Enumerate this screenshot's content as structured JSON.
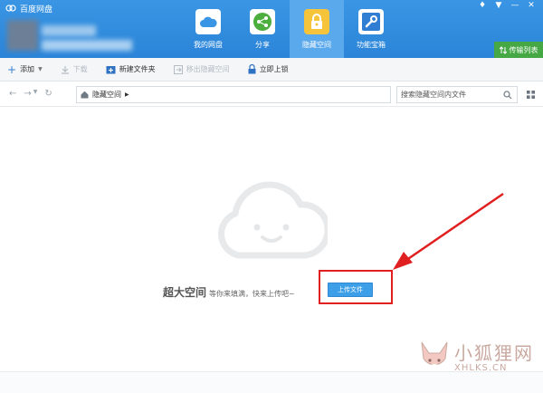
{
  "app": {
    "title": "百度网盘"
  },
  "nav": {
    "tabs": [
      {
        "label": "我的网盘",
        "icon": "cloud-icon",
        "active": false
      },
      {
        "label": "分享",
        "icon": "share-icon",
        "active": false
      },
      {
        "label": "隐藏空间",
        "icon": "lock-icon",
        "active": true
      },
      {
        "label": "功能宝箱",
        "icon": "tools-icon",
        "active": false
      }
    ]
  },
  "window_controls": [
    "bell-icon",
    "menu-icon",
    "minimize-icon",
    "close-icon"
  ],
  "transfer": {
    "label": "传输列表"
  },
  "toolbar": {
    "add": "添加",
    "download": "下载",
    "new_folder": "新建文件夹",
    "move_out": "移出隐藏空间",
    "lock_now": "立即上锁"
  },
  "address": {
    "path": "隐藏空间",
    "search_placeholder": "搜索隐藏空间内文件"
  },
  "empty": {
    "title": "超大空间",
    "subtitle": "等你来填满，快来上传吧~",
    "upload_label": "上传文件"
  },
  "watermark": {
    "cn": "小狐狸网",
    "en": "XHLKS.CN"
  },
  "colors": {
    "header": "#2b84d8",
    "active_tab": "#5aa9ec",
    "transfer": "#46a844",
    "upload": "#3d9fe8",
    "highlight": "#e02020"
  }
}
